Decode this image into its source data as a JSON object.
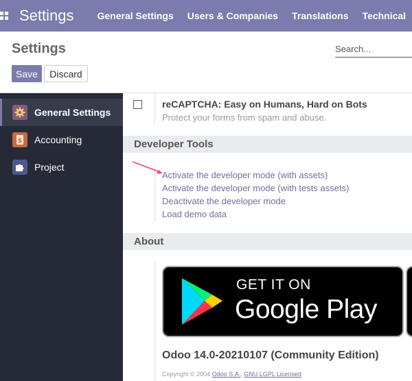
{
  "navbar": {
    "icon": "apps-grid-icon",
    "brand": "Settings",
    "menu": [
      "General Settings",
      "Users & Companies",
      "Translations",
      "Technical"
    ]
  },
  "control_panel": {
    "title": "Settings",
    "search_placeholder": "Search...",
    "save_label": "Save",
    "discard_label": "Discard"
  },
  "sidebar": {
    "items": [
      {
        "label": "General Settings",
        "icon": "gear-icon",
        "active": true
      },
      {
        "label": "Accounting",
        "icon": "accounting-icon",
        "active": false
      },
      {
        "label": "Project",
        "icon": "puzzle-icon",
        "active": false
      }
    ]
  },
  "settings": {
    "recaptcha": {
      "title": "reCAPTCHA: Easy on Humans, Hard on Bots",
      "description": "Protect your forms from spam and abuse.",
      "checked": false
    },
    "developer_tools": {
      "header": "Developer Tools",
      "links": [
        "Activate the developer mode (with assets)",
        "Activate the developer mode (with tests assets)",
        "Deactivate the developer mode",
        "Load demo data"
      ]
    },
    "about": {
      "header": "About",
      "badge_top": "GET IT ON",
      "badge_main": "Google Play",
      "version": "Odoo 14.0-20210107 (Community Edition)",
      "copyright_prefix": "Copyright © 2004",
      "company_link": "Odoo S.A.",
      "license_link": "GNU LGPL Licensed"
    }
  },
  "colors": {
    "brand": "#7c7bad",
    "sidebar_bg": "#262a36",
    "link": "#6f6e9e",
    "annotation_arrow": "#f0417a"
  }
}
